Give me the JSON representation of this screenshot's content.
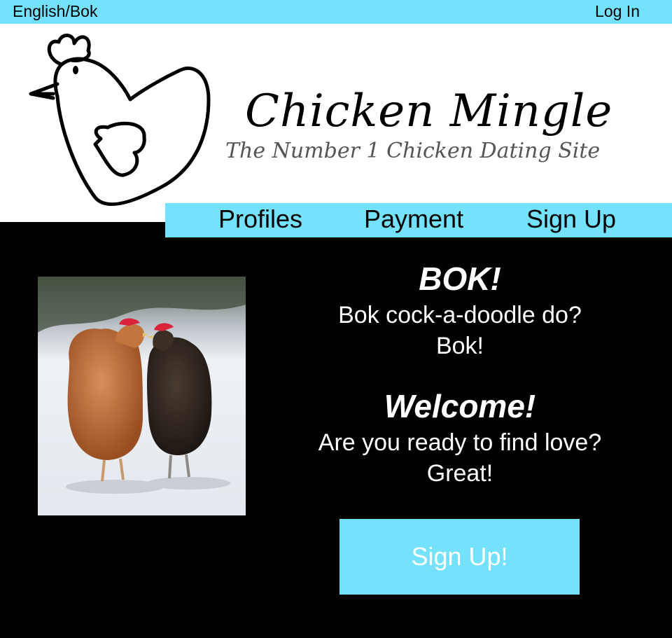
{
  "topbar": {
    "language_label": "English/Bok",
    "login_label": "Log In"
  },
  "brand": {
    "title": "Chicken Mingle",
    "tagline": "The Number 1 Chicken Dating Site",
    "logo_icon": "chicken-heart-logo"
  },
  "nav": {
    "items": [
      {
        "label": "Profiles"
      },
      {
        "label": "Payment"
      },
      {
        "label": "Sign Up"
      }
    ]
  },
  "hero": {
    "photo_icon": "two-chickens-photo"
  },
  "content": {
    "heading1": "BOK!",
    "line1": "Bok cock-a-doodle do?",
    "line2": "Bok!",
    "heading2": "Welcome!",
    "line3": "Are you ready to find love?",
    "line4": "Great!"
  },
  "cta": {
    "label": "Sign Up!"
  },
  "colors": {
    "accent": "#74e2fd",
    "background": "#000000",
    "header_background": "#ffffff",
    "tagline": "#555555"
  }
}
